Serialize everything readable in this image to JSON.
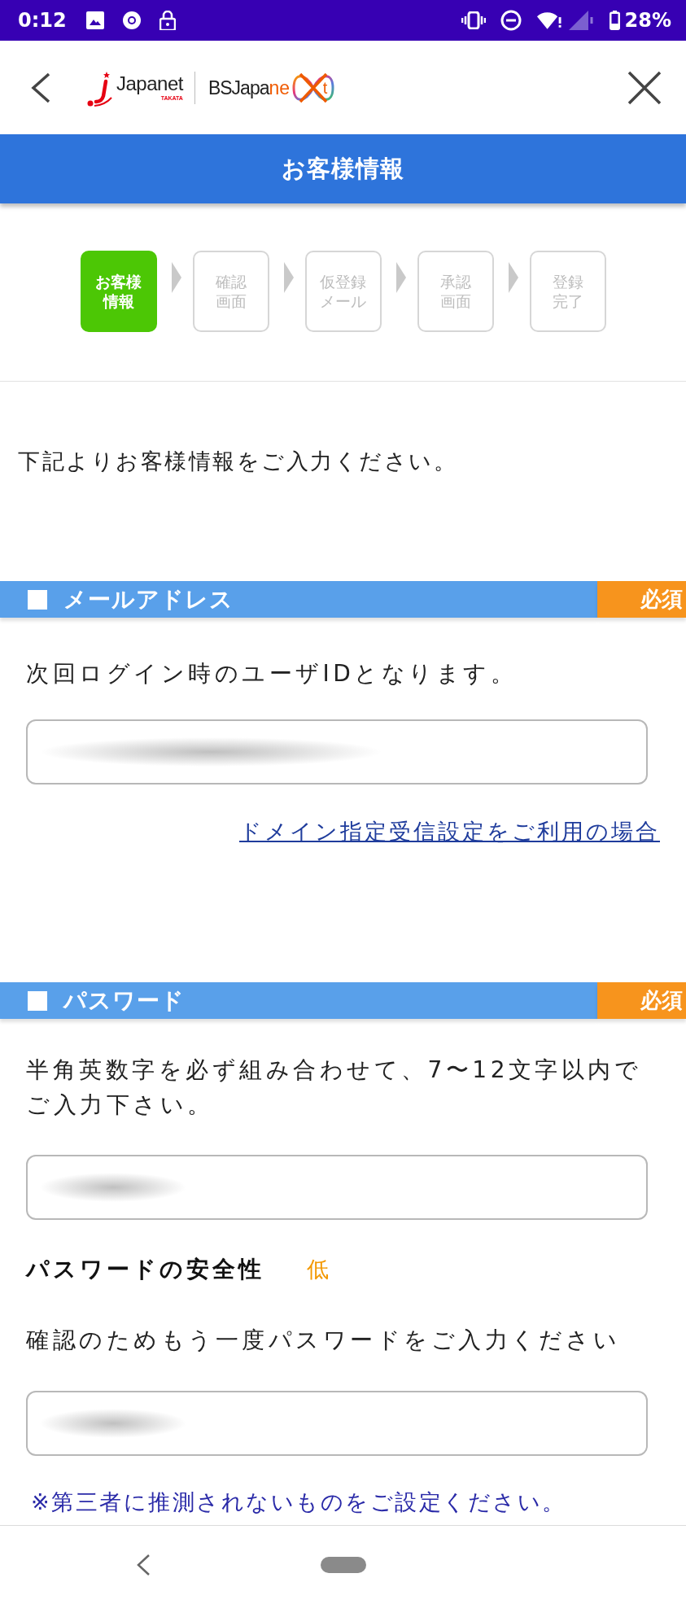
{
  "status_bar": {
    "time": "0:12",
    "battery": "28%"
  },
  "header": {
    "brand_logo": {
      "name": "Japanet",
      "sub": "TAKATA"
    },
    "partner_logo": {
      "lead": "BSJapa",
      "accent": "ne",
      "tail": "t"
    }
  },
  "title": "お客様情報",
  "steps": [
    {
      "lines": [
        "お客様",
        "情報"
      ],
      "selected": true
    },
    {
      "lines": [
        "確認",
        "画面"
      ],
      "selected": false
    },
    {
      "lines": [
        "仮登録",
        "メール"
      ],
      "selected": false
    },
    {
      "lines": [
        "承認",
        "画面"
      ],
      "selected": false
    },
    {
      "lines": [
        "登録",
        "完了"
      ],
      "selected": false
    }
  ],
  "intro": "下記よりお客様情報をご入力ください。",
  "email_section": {
    "title": "メールアドレス",
    "badge": "必須",
    "description": "次回ログイン時のユーザIDとなります。",
    "input": {
      "redacted": true
    },
    "link": "ドメイン指定受信設定をご利用の場合"
  },
  "password_section": {
    "title": "パスワード",
    "badge": "必須",
    "description": "半角英数字を必ず組み合わせて、7〜12文字以内でご入力下さい。",
    "input": {
      "redacted": true
    },
    "strength_label": "パスワードの安全性",
    "strength_value": "低",
    "confirm_label": "確認のためもう一度パスワードをご入力ください",
    "confirm_input": {
      "redacted": true
    },
    "note": "※第三者に推測されないものをご設定ください。"
  }
}
